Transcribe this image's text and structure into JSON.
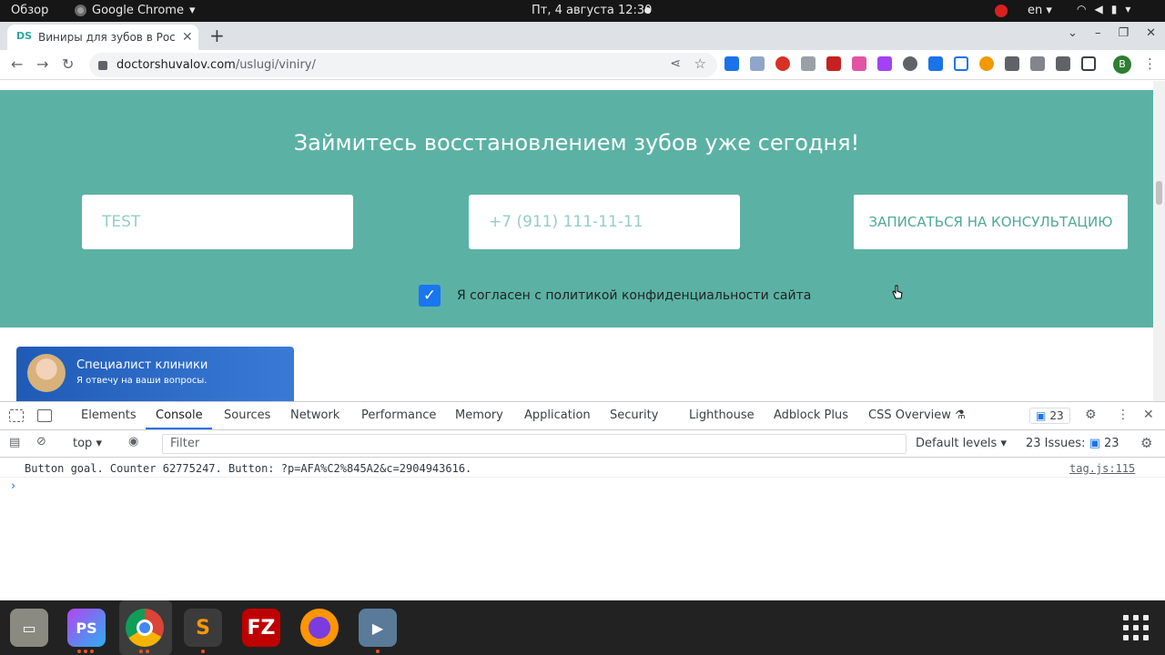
{
  "topbar": {
    "overview": "Обзор",
    "app_name": "Google Chrome",
    "clock": "Пт, 4 августа  12:30",
    "lang": "en"
  },
  "browser": {
    "tab_title": "Виниры для зубов в Рост",
    "url_domain": "doctorshuvalov.com",
    "url_path": "/uslugi/viniry/",
    "profile_letter": "В"
  },
  "page": {
    "heading": "Займитесь восстановлением зубов уже сегодня!",
    "name_value": "TEST",
    "phone_placeholder": "+7 (911) 111-11-11",
    "submit_label": "ЗАПИСАТЬСЯ НА КОНСУЛЬТАЦИЮ",
    "consent_label": "Я согласен с политикой конфиденциальности сайта",
    "consent_checked": true,
    "specialist_title": "Специалист клиники",
    "specialist_subtitle": "Я отвечу на ваши вопросы."
  },
  "devtools": {
    "tabs": [
      "Elements",
      "Console",
      "Sources",
      "Network",
      "Performance",
      "Memory",
      "Application",
      "Security",
      "Lighthouse",
      "Adblock Plus",
      "CSS Overview"
    ],
    "active_tab": "Console",
    "issues_badge": "23",
    "context": "top",
    "filter_placeholder": "Filter",
    "levels": "Default levels",
    "issues_label": "23 Issues:",
    "issues_count": "23",
    "messages": [
      {
        "text": "Button goal. Counter 62775247. Button: ?p=AFA%C2%845A2&c=2904943616.",
        "source": "tag.js:115"
      }
    ]
  },
  "colors": {
    "hero_bg": "#5bb2a4",
    "accent": "#1a73e8",
    "checkbox": "#1976f0"
  }
}
